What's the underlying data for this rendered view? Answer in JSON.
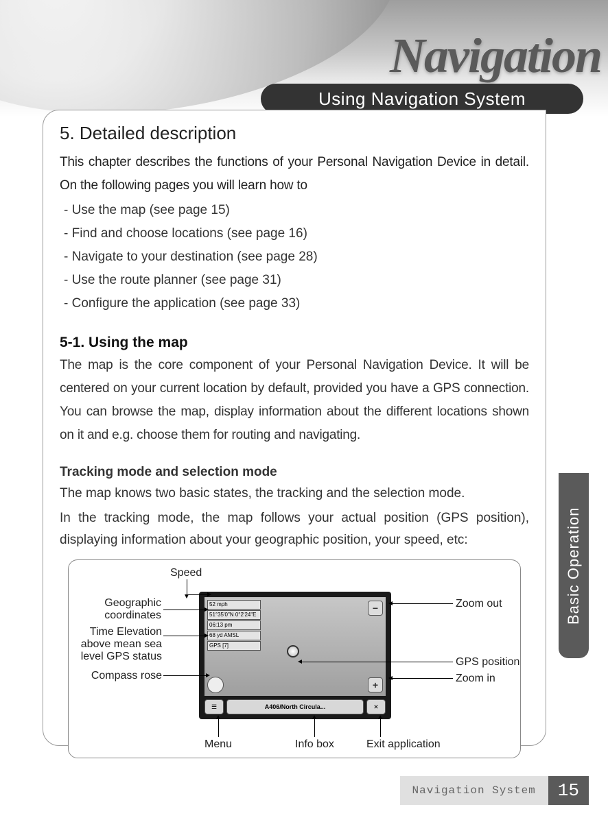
{
  "hero": {
    "brand": "Navigation",
    "chapter": "Using Navigation System"
  },
  "section": {
    "title": "5. Detailed description",
    "intro": "This chapter describes the functions of your Personal Navigation Device in detail. On the following pages you will learn how to",
    "bullets": [
      "Use the map (see page 15)",
      "Find and choose locations (see page 16)",
      "Navigate to your destination (see page 28)",
      "Use the route planner (see page 31)",
      "Configure the application (see page 33)"
    ]
  },
  "subsection": {
    "title": "5-1. Using the map",
    "para": "The map is the core component of your Personal Navigation Device. It will be centered on your current location by default, provided you have a GPS connection. You can browse the map, display information about the different locations shown on it and e.g. choose them for routing and navigating."
  },
  "tracking": {
    "heading": "Tracking mode and selection mode",
    "line1": "The map knows two basic states, the tracking and the selection mode.",
    "line2": "In the tracking mode, the map follows your actual position (GPS position), displaying information about your geographic position, your speed, etc:"
  },
  "diagram": {
    "labels": {
      "speed": "Speed",
      "geo": "Geographic\ncoordinates",
      "time": "Time Elevation\nabove mean sea\nlevel GPS status",
      "compass": "Compass rose",
      "menu": "Menu",
      "info": "Info box",
      "exit": "Exit application",
      "zoomout": "Zoom out",
      "gpspos": "GPS position",
      "zoomin": "Zoom in"
    },
    "screen": {
      "speed": "52 mph",
      "coords": "51°35'0\"N 0°2'24\"E",
      "time": "06:13 pm",
      "elev": "68 yd AMSL",
      "gps": "GPS [7]",
      "infobar": "A406/North Circula...",
      "zoom_out_glyph": "−",
      "zoom_in_glyph": "+"
    }
  },
  "sidetab": "Basic Operation",
  "footer": {
    "label": "Navigation System",
    "page": "15"
  }
}
